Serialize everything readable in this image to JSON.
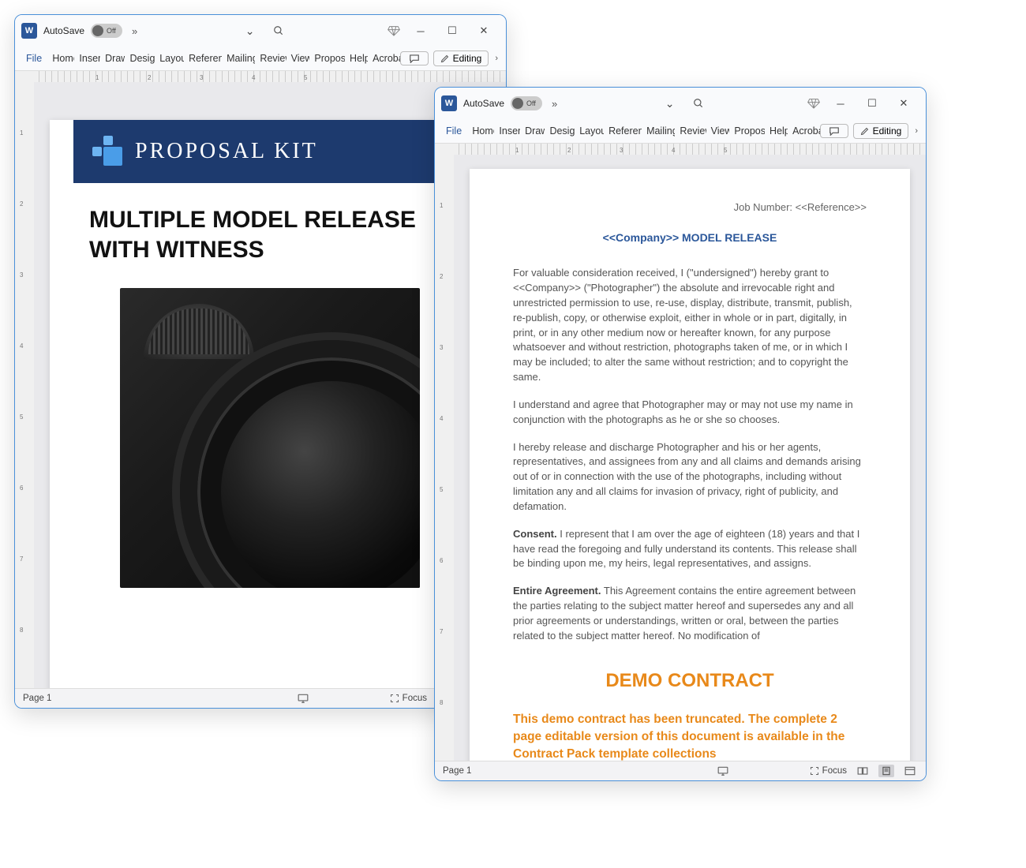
{
  "windows": [
    {
      "autosave_label": "AutoSave",
      "autosave_state": "Off",
      "editing_label": "Editing",
      "page_status": "Page 1",
      "focus_label": "Focus"
    },
    {
      "autosave_label": "AutoSave",
      "autosave_state": "Off",
      "editing_label": "Editing",
      "page_status": "Page 1",
      "focus_label": "Focus"
    }
  ],
  "ribbon_tabs": [
    "File",
    "Home",
    "Insert",
    "Draw",
    "Design",
    "Layout",
    "References",
    "Mailings",
    "Review",
    "View",
    "Proposal",
    "Help",
    "Acrobat"
  ],
  "ruler_h": [
    "1",
    "2",
    "3",
    "4",
    "5"
  ],
  "ruler_v": [
    "1",
    "2",
    "3",
    "4",
    "5",
    "6",
    "7",
    "8"
  ],
  "doc1": {
    "brand": "PROPOSAL KIT",
    "title_line1": "MULTIPLE MODEL RELEASE",
    "title_line2": "WITH WITNESS"
  },
  "doc2": {
    "job_number": "Job Number: <<Reference>>",
    "title": "<<Company>> MODEL RELEASE",
    "p1": "For valuable consideration received, I (\"undersigned\") hereby grant to <<Company>> (\"Photographer\") the absolute and irrevocable right and unrestricted permission to use, re-use, display, distribute, transmit, publish, re-publish, copy, or otherwise exploit, either in whole or in part, digitally, in print, or in any other medium now or hereafter known, for any purpose whatsoever and without restriction, photographs taken of me, or in which I may be included; to alter the same without restriction; and to copyright the same.",
    "p2": "I understand and agree that Photographer may or may not use my name in conjunction with the photographs as he or she so chooses.",
    "p3": "I hereby release and discharge Photographer and his or her agents, representatives, and assignees from any and all claims and demands arising out of or in connection with the use of the photographs, including without limitation any and all claims for invasion of privacy, right of publicity, and defamation.",
    "p4_label": "Consent.",
    "p4": "  I represent that I am over the age of eighteen (18) years and that I have read the foregoing and fully understand its contents. This release shall be binding upon me, my heirs, legal representatives, and assigns.",
    "p5_label": "Entire Agreement.",
    "p5": "  This Agreement contains the entire agreement between the parties relating to the subject matter hereof and supersedes any and all prior agreements or understandings, written or oral, between the parties related to the subject matter hereof.  No modification of",
    "demo_title": "DEMO CONTRACT",
    "demo_text": "This demo contract has been truncated. The complete 2 page editable version of this document is available in the Contract Pack template collections"
  }
}
